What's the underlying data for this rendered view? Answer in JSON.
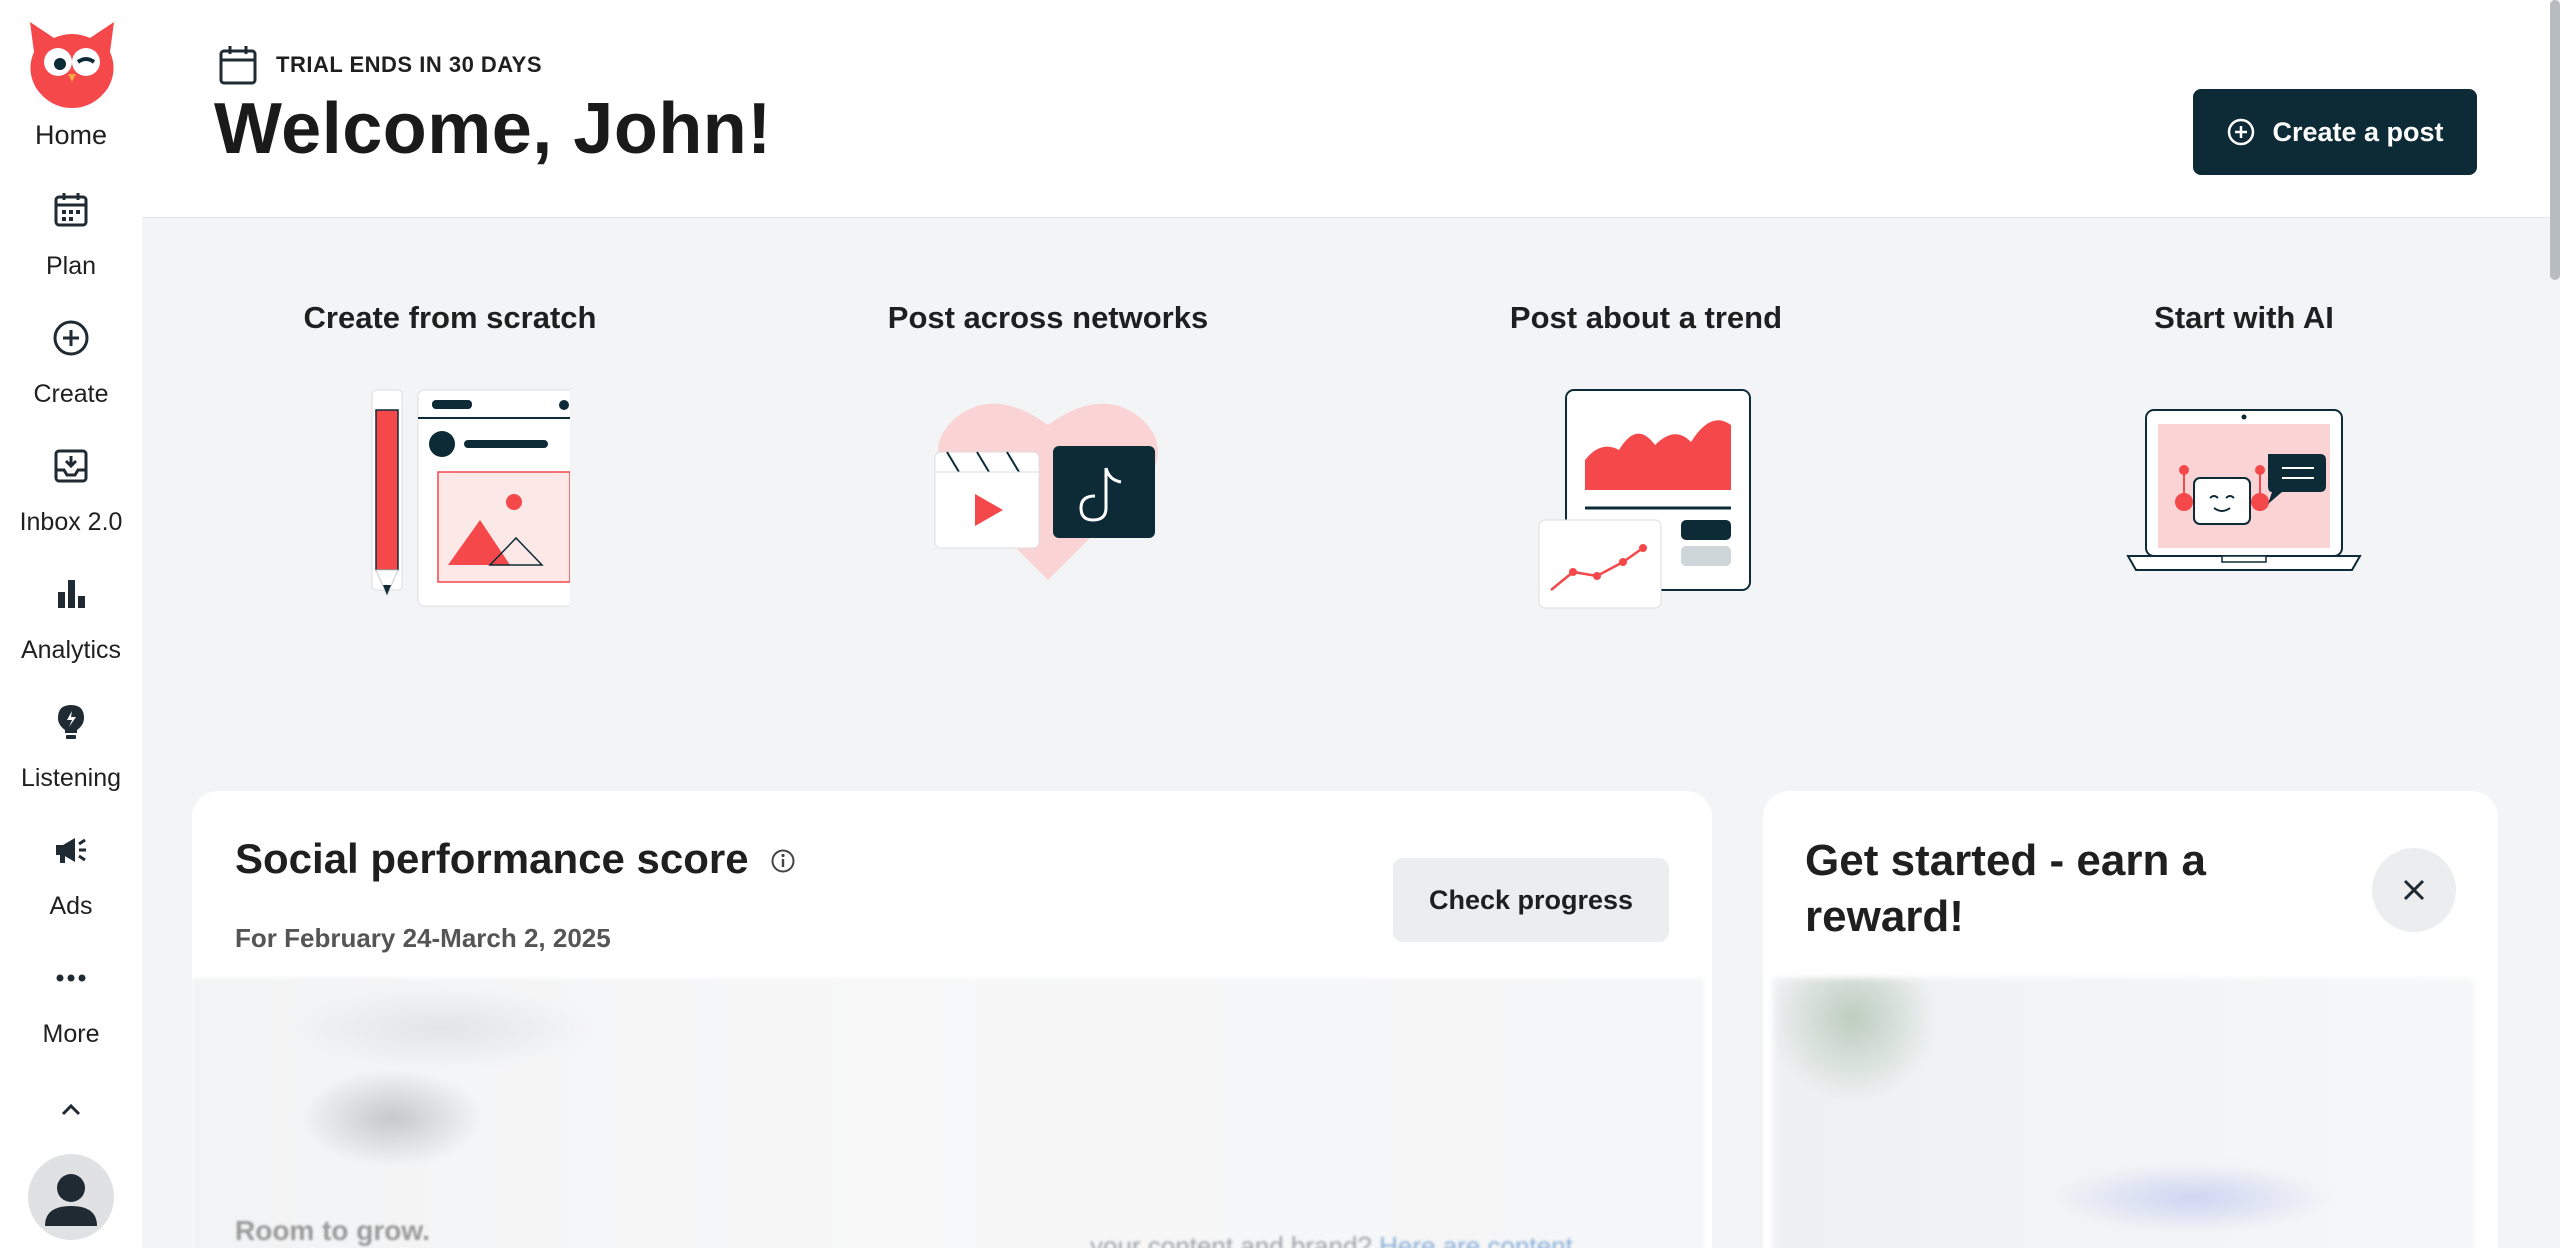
{
  "sidebar": {
    "logo_icon": "owl-logo-icon",
    "items": [
      {
        "label": "Home",
        "icon": "owl-logo-icon"
      },
      {
        "label": "Plan",
        "icon": "calendar-icon"
      },
      {
        "label": "Create",
        "icon": "plus-circle-icon"
      },
      {
        "label": "Inbox 2.0",
        "icon": "inbox-icon"
      },
      {
        "label": "Analytics",
        "icon": "bar-chart-icon"
      },
      {
        "label": "Listening",
        "icon": "lightbulb-icon"
      },
      {
        "label": "Ads",
        "icon": "megaphone-icon"
      },
      {
        "label": "More",
        "icon": "more-dots-icon"
      }
    ],
    "collapse_icon": "chevron-up-icon",
    "avatar_icon": "user-avatar-icon"
  },
  "header": {
    "trial_text": "TRIAL ENDS IN 30 DAYS",
    "welcome": "Welcome, John!",
    "create_post_label": "Create a post"
  },
  "quick_start": [
    {
      "title": "Create from scratch",
      "icon": "pencil-post-illustration"
    },
    {
      "title": "Post across networks",
      "icon": "networks-heart-illustration"
    },
    {
      "title": "Post about a trend",
      "icon": "trend-chart-illustration"
    },
    {
      "title": "Start with AI",
      "icon": "ai-robot-laptop-illustration"
    }
  ],
  "social_card": {
    "title": "Social performance score",
    "date_range": "For February 24-March 2, 2025",
    "check_label": "Check progress",
    "status_text": "Room to grow.",
    "blurred_text": "your content and brand?",
    "blurred_link": "Here are content"
  },
  "get_started_card": {
    "title": "Get started - earn a reward!"
  },
  "colors": {
    "brand_red": "#f4484b",
    "dark_navy": "#0d2b36",
    "page_bg": "#f3f4f6"
  }
}
